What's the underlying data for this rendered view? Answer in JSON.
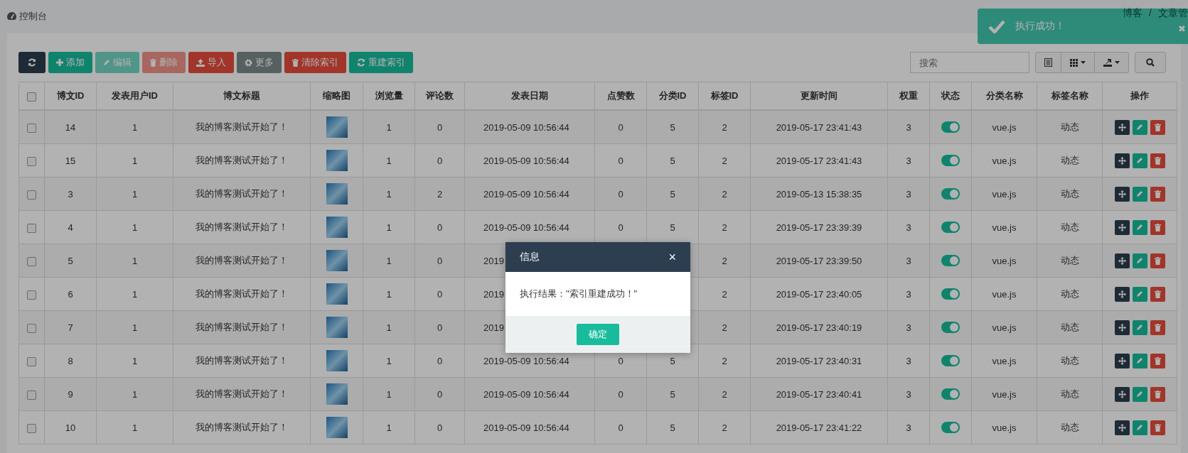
{
  "header": {
    "title": "控制台",
    "breadcrumb": [
      "博客",
      "/",
      "文章管"
    ]
  },
  "toast": {
    "message": "执行成功！",
    "close": "✖"
  },
  "toolbar": {
    "buttons": [
      {
        "kind": "refresh",
        "disabled": false
      },
      {
        "kind": "add",
        "label": "添加",
        "disabled": false
      },
      {
        "kind": "edit",
        "label": "编辑",
        "disabled": true
      },
      {
        "kind": "delete",
        "label": "删除",
        "disabled": true
      },
      {
        "kind": "import",
        "label": "导入",
        "disabled": false
      },
      {
        "kind": "more",
        "label": "更多",
        "disabled": false
      },
      {
        "kind": "clear",
        "label": "清除索引",
        "disabled": false
      },
      {
        "kind": "rebuild",
        "label": "重建索引",
        "disabled": false
      }
    ],
    "search": {
      "placeholder": "搜索"
    }
  },
  "table": {
    "header_checked": false,
    "columns": [
      "博文ID",
      "发表用户ID",
      "博文标题",
      "缩略图",
      "浏览量",
      "评论数",
      "发表日期",
      "点赞数",
      "分类ID",
      "标签ID",
      "更新时间",
      "权重",
      "状态",
      "分类名称",
      "标签名称",
      "操作"
    ],
    "rows": [
      {
        "checked": false,
        "id": "14",
        "user_id": "1",
        "title": "我的博客测试开始了！",
        "views": "1",
        "comments": "0",
        "date": "2019-05-09 10:56:44",
        "likes": "0",
        "category_id": "5",
        "tag_id": "2",
        "updated": "2019-05-17 23:41:43",
        "weight": "3",
        "status_on": true,
        "category": "vue.js",
        "tag": "动态"
      },
      {
        "checked": false,
        "id": "15",
        "user_id": "1",
        "title": "我的博客测试开始了！",
        "views": "1",
        "comments": "0",
        "date": "2019-05-09 10:56:44",
        "likes": "0",
        "category_id": "5",
        "tag_id": "2",
        "updated": "2019-05-17 23:41:43",
        "weight": "3",
        "status_on": true,
        "category": "vue.js",
        "tag": "动态"
      },
      {
        "checked": false,
        "id": "3",
        "user_id": "1",
        "title": "我的博客测试开始了！",
        "views": "1",
        "comments": "2",
        "date": "2019-05-09 10:56:44",
        "likes": "0",
        "category_id": "5",
        "tag_id": "2",
        "updated": "2019-05-13 15:38:35",
        "weight": "3",
        "status_on": true,
        "category": "vue.js",
        "tag": "动态"
      },
      {
        "checked": false,
        "id": "4",
        "user_id": "1",
        "title": "我的博客测试开始了！",
        "views": "1",
        "comments": "0",
        "date": "2019-05-09 10:56:44",
        "likes": "0",
        "category_id": "5",
        "tag_id": "2",
        "updated": "2019-05-17 23:39:39",
        "weight": "3",
        "status_on": true,
        "category": "vue.js",
        "tag": "动态"
      },
      {
        "checked": false,
        "id": "5",
        "user_id": "1",
        "title": "我的博客测试开始了！",
        "views": "1",
        "comments": "0",
        "date": "2019",
        "tag_id": "2",
        "updated": "2019-05-17 23:39:50",
        "weight": "3",
        "status_on": true,
        "category": "vue.js",
        "tag": "动态"
      },
      {
        "checked": false,
        "id": "6",
        "user_id": "1",
        "title": "我的博客测试开始了！",
        "views": "1",
        "comments": "0",
        "date": "2019",
        "tag_id": "2",
        "updated": "2019-05-17 23:40:05",
        "weight": "3",
        "status_on": true,
        "category": "vue.js",
        "tag": "动态"
      },
      {
        "checked": false,
        "id": "7",
        "user_id": "1",
        "title": "我的博客测试开始了！",
        "views": "1",
        "comments": "0",
        "date": "2019",
        "tag_id": "2",
        "updated": "2019-05-17 23:40:19",
        "weight": "3",
        "status_on": true,
        "category": "vue.js",
        "tag": "动态"
      },
      {
        "checked": false,
        "id": "8",
        "user_id": "1",
        "title": "我的博客测试开始了！",
        "views": "1",
        "comments": "0",
        "date": "2019-05-09 10:56:44",
        "likes": "0",
        "category_id": "5",
        "tag_id": "2",
        "updated": "2019-05-17 23:40:31",
        "weight": "3",
        "status_on": true,
        "category": "vue.js",
        "tag": "动态"
      },
      {
        "checked": false,
        "id": "9",
        "user_id": "1",
        "title": "我的博客测试开始了！",
        "views": "1",
        "comments": "0",
        "date": "2019-05-09 10:56:44",
        "likes": "0",
        "category_id": "5",
        "tag_id": "2",
        "updated": "2019-05-17 23:40:41",
        "weight": "3",
        "status_on": true,
        "category": "vue.js",
        "tag": "动态"
      },
      {
        "checked": false,
        "id": "10",
        "user_id": "1",
        "title": "我的博客测试开始了！",
        "views": "1",
        "comments": "0",
        "date": "2019-05-09 10:56:44",
        "likes": "0",
        "category_id": "5",
        "tag_id": "2",
        "updated": "2019-05-17 23:41:22",
        "weight": "3",
        "status_on": true,
        "category": "vue.js",
        "tag": "动态"
      }
    ]
  },
  "dialog": {
    "title": "信息",
    "close": "×",
    "message": "执行结果：\"索引重建成功！\"",
    "ok": "确定"
  }
}
